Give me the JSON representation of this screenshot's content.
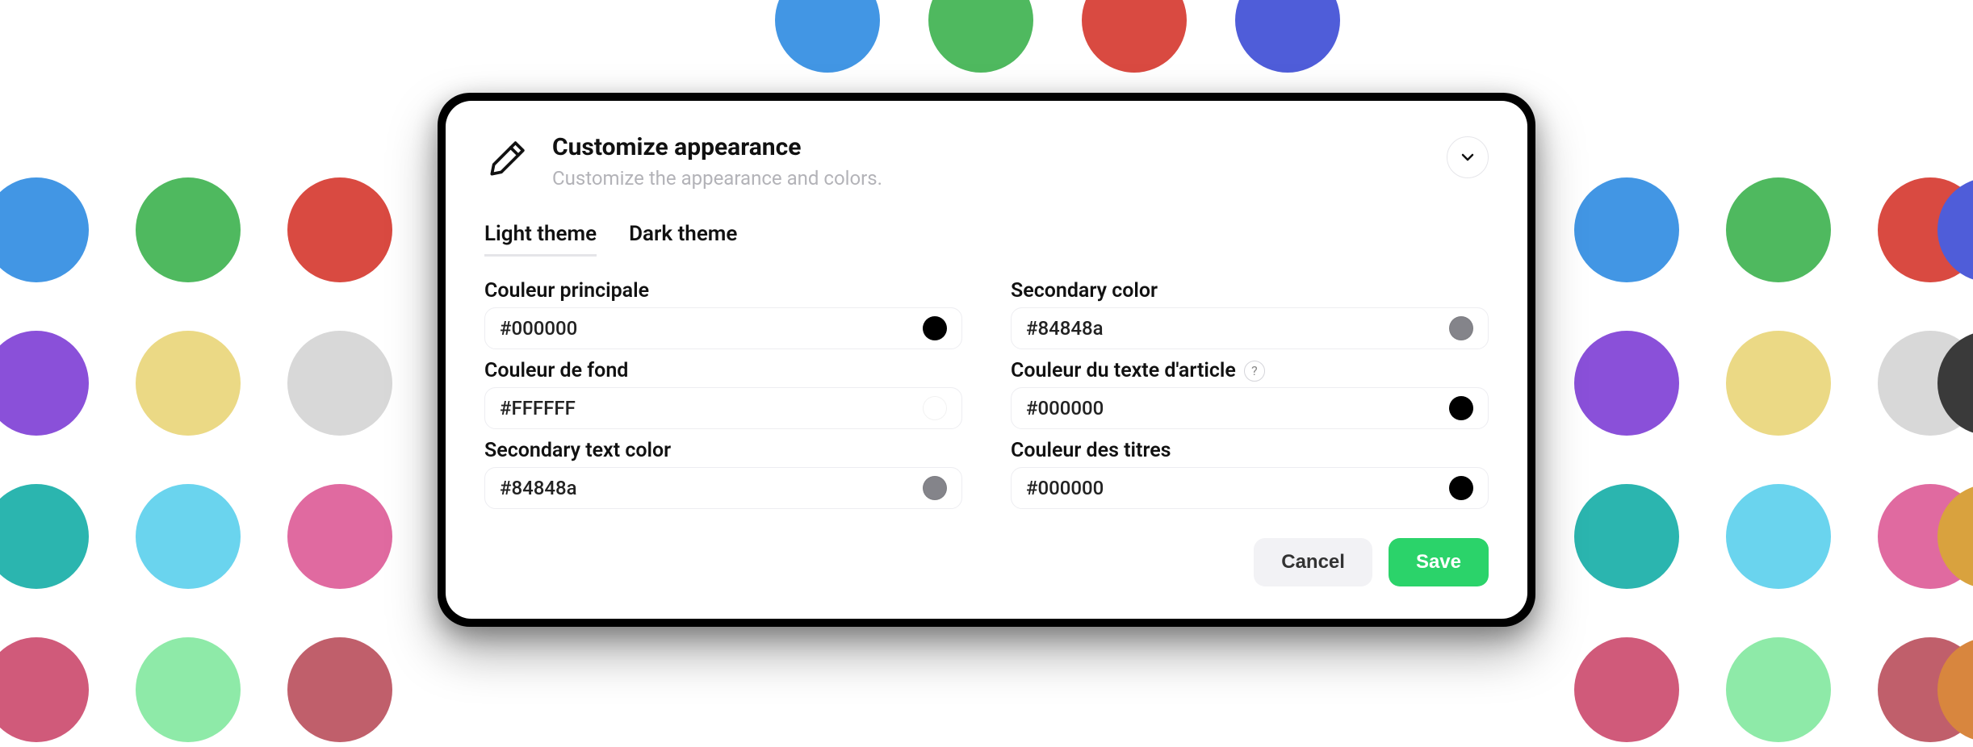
{
  "header": {
    "title": "Customize appearance",
    "subtitle": "Customize the appearance and colors."
  },
  "tabs": {
    "light": "Light theme",
    "dark": "Dark theme"
  },
  "fields": {
    "primary": {
      "label": "Couleur principale",
      "value": "#000000",
      "swatch": "#000000"
    },
    "secondary": {
      "label": "Secondary color",
      "value": "#84848a",
      "swatch": "#84848a"
    },
    "bg": {
      "label": "Couleur de fond",
      "value": "#FFFFFF",
      "swatch": "#FFFFFF"
    },
    "article": {
      "label": "Couleur du texte d'article",
      "value": "#000000",
      "swatch": "#000000"
    },
    "sectext": {
      "label": "Secondary text color",
      "value": "#84848a",
      "swatch": "#84848a"
    },
    "titles": {
      "label": "Couleur des titres",
      "value": "#000000",
      "swatch": "#000000"
    }
  },
  "buttons": {
    "cancel": "Cancel",
    "save": "Save"
  },
  "help_glyph": "?",
  "bg_dots": {
    "colors": {
      "blue": "#4296e4",
      "green": "#4fb95f",
      "red": "#d94a41",
      "indigo": "#4f5dd9",
      "purple": "#8a50d9",
      "yellow": "#ebd985",
      "silver": "#d8d8d8",
      "dark": "#3a3a3a",
      "teal": "#2bb5af",
      "cyan": "#6ad4ee",
      "pink": "#e06aa0",
      "gold": "#d9a23e",
      "rose": "#d05a7a",
      "mint": "#8eeaa8",
      "mauve": "#c05f6b",
      "orange": "#d8863e"
    }
  }
}
